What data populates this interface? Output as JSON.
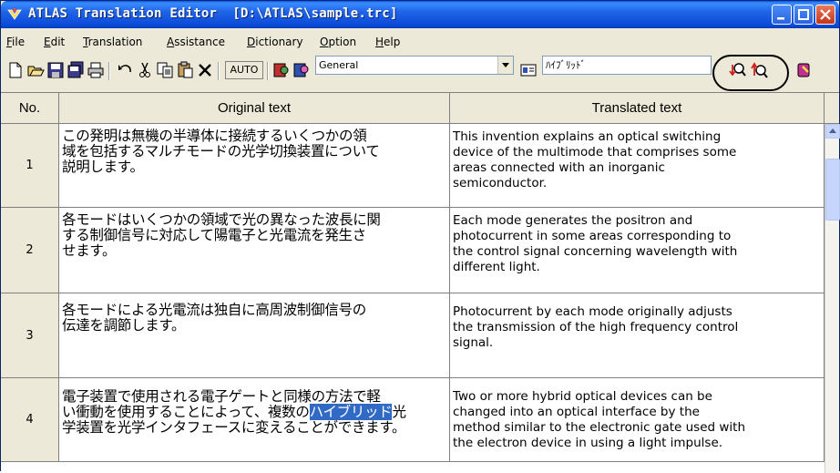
{
  "window": {
    "title": "ATLAS Translation Editor  [D:\\ATLAS\\sample.trc]"
  },
  "menu": [
    {
      "label": "File",
      "underline": "F"
    },
    {
      "label": "Edit",
      "underline": "E"
    },
    {
      "label": "Translation",
      "underline": "T"
    },
    {
      "label": "Assistance",
      "underline": "A"
    },
    {
      "label": "Dictionary",
      "underline": "D"
    },
    {
      "label": "Option",
      "underline": "O"
    },
    {
      "label": "Help",
      "underline": "H"
    }
  ],
  "toolbar": {
    "auto_label": "AUTO",
    "field_combo_value": "General",
    "term_field_value": "ﾊｲﾌﾞﾘｯﾄﾞ",
    "icons": [
      "new-file-icon",
      "open-folder-icon",
      "save-icon",
      "save-all-icon",
      "print-icon",
      "undo-icon",
      "cut-icon",
      "copy-icon",
      "paste-icon",
      "delete-icon",
      "auto-translate",
      "dictionary-look-icon",
      "dictionary-search-icon",
      "field-combo",
      "term-icon",
      "term-input",
      "search-down-icon",
      "search-up-icon",
      "assistance-icon"
    ]
  },
  "columns": {
    "no": "No.",
    "original": "Original text",
    "translated": "Translated text"
  },
  "rows": [
    {
      "no": "1",
      "original_lines": [
        "この発明は無機の半導体に接続するいくつかの領",
        "域を包括するマルチモードの光学切換装置について",
        "説明します。"
      ],
      "translated_lines": [
        "This invention explains an optical switching",
        "device of the multimode that comprises some",
        "areas connected with an inorganic",
        "semiconductor."
      ]
    },
    {
      "no": "2",
      "original_lines": [
        "各モードはいくつかの領域で光の異なった波長に関",
        "する制御信号に対応して陽電子と光電流を発生さ",
        "せます。"
      ],
      "translated_lines": [
        "Each mode generates the positron and",
        "photocurrent in some areas corresponding to",
        "the control signal concerning wavelength with",
        "different light."
      ]
    },
    {
      "no": "3",
      "original_lines": [
        "各モードによる光電流は独自に高周波制御信号の",
        "伝達を調節します。"
      ],
      "translated_lines": [
        "Photocurrent by each mode originally adjusts",
        "the transmission of the high frequency control",
        "signal."
      ]
    },
    {
      "no": "4",
      "original_lines": [
        "電子装置で使用される電子ゲートと同様の方法で軽",
        "い衝動を使用することによって、複数の",
        "学装置を光学インタフェースに変えることができます。"
      ],
      "selected_text": "ハイブリッド",
      "after_selected": "光",
      "translated_lines": [
        "Two or more hybrid optical devices can be",
        "changed into an optical interface by the",
        "method similar to the electronic gate used with",
        "the electron device in using a light impulse."
      ]
    }
  ]
}
